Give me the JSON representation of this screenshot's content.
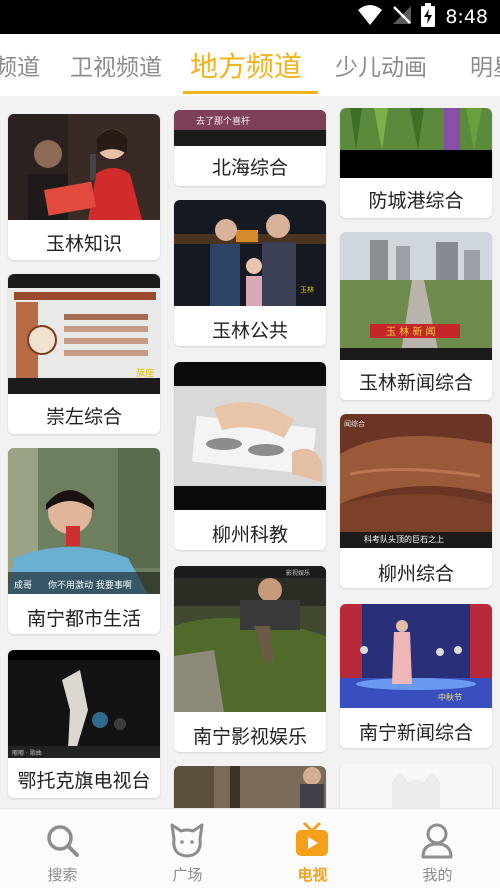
{
  "status_bar": {
    "time": "8:48"
  },
  "tabs": [
    {
      "label": "频道",
      "active": false
    },
    {
      "label": "卫视频道",
      "active": false
    },
    {
      "label": "地方频道",
      "active": true
    },
    {
      "label": "少儿动画",
      "active": false
    },
    {
      "label": "明星",
      "active": false
    }
  ],
  "channels": {
    "col1": [
      {
        "label": "玉林知识",
        "thumb_icon": "woman-singing-microphone"
      },
      {
        "label": "崇左综合",
        "thumb_icon": "exhibition-board"
      },
      {
        "label": "南宁都市生活",
        "thumb_icon": "woman-singing-outdoors",
        "subtitle": "你不用激动  我要事啊"
      },
      {
        "label": "鄂托克旗电视台",
        "thumb_icon": "puppet-sculpture"
      }
    ],
    "col2": [
      {
        "label": "北海综合",
        "thumb_icon": "dark-video-frame"
      },
      {
        "label": "玉林公共",
        "thumb_icon": "family-night-scene"
      },
      {
        "label": "柳州科教",
        "thumb_icon": "hands-reading-paper"
      },
      {
        "label": "南宁影视娱乐",
        "thumb_icon": "person-in-grass"
      },
      {
        "label": "",
        "thumb_icon": "street-scene"
      }
    ],
    "col3": [
      {
        "label": "防城港综合",
        "thumb_icon": "plants-closeup"
      },
      {
        "label": "玉林新闻综合",
        "thumb_icon": "city-aerial-view"
      },
      {
        "label": "柳州综合",
        "thumb_icon": "red-rock-cliff",
        "subtitle": "科考队头顶的巨石之上"
      },
      {
        "label": "南宁新闻综合",
        "thumb_icon": "stage-performance"
      },
      {
        "label": "",
        "thumb_icon": "placeholder-logo"
      }
    ]
  },
  "bottom_nav": [
    {
      "label": "搜索",
      "icon": "search-icon",
      "active": false
    },
    {
      "label": "广场",
      "icon": "cat-face-icon",
      "active": false
    },
    {
      "label": "电视",
      "icon": "tv-icon",
      "active": true
    },
    {
      "label": "我的",
      "icon": "user-icon",
      "active": false
    }
  ],
  "colors": {
    "accent": "#f5b21b",
    "inactive": "#8d8d8d",
    "background": "#f2f2f2"
  }
}
